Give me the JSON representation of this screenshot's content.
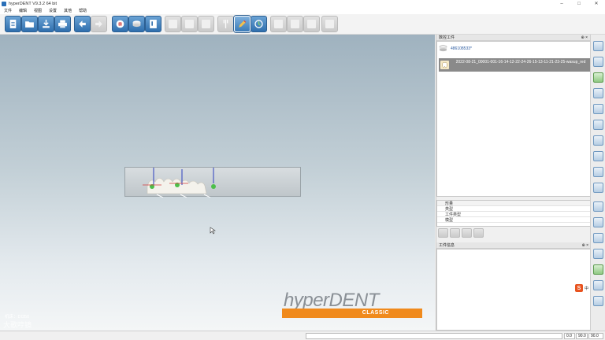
{
  "window": {
    "title": "hyperDENT V9.3.2 64 bit",
    "minimize": "–",
    "maximize": "□",
    "close": "✕"
  },
  "menu": [
    "文件",
    "编辑",
    "视图",
    "设置",
    "其他",
    "帮助"
  ],
  "toolbar": {
    "buttons": [
      {
        "icon": "new-document-icon",
        "state": "enabled"
      },
      {
        "icon": "open-folder-icon",
        "state": "enabled"
      },
      {
        "icon": "import-icon",
        "state": "enabled"
      },
      {
        "icon": "print-icon",
        "state": "enabled"
      },
      {
        "icon": "undo-arrow-icon",
        "state": "enabled"
      },
      {
        "icon": "redo-arrow-icon",
        "state": "disabled"
      },
      {
        "icon": "tooth-job-icon",
        "state": "enabled"
      },
      {
        "icon": "blank-disc-icon",
        "state": "enabled"
      },
      {
        "icon": "machine-icon",
        "state": "enabled"
      },
      {
        "icon": "grey-tool-1-icon",
        "state": "disabled"
      },
      {
        "icon": "grey-tool-2-icon",
        "state": "disabled"
      },
      {
        "icon": "grey-tool-3-icon",
        "state": "disabled"
      },
      {
        "icon": "fork-icon",
        "state": "enabled"
      },
      {
        "icon": "pencil-icon",
        "state": "active"
      },
      {
        "icon": "calculate-icon",
        "state": "enabled"
      },
      {
        "icon": "hand-icon",
        "state": "disabled"
      },
      {
        "icon": "gear-icon",
        "state": "disabled"
      },
      {
        "icon": "export-icon",
        "state": "disabled"
      },
      {
        "icon": "sync-icon",
        "state": "disabled"
      }
    ]
  },
  "viewport": {
    "machine_label": "机床：DI350",
    "brand_name": "hyperDENT",
    "brand_edition": "CLASSIC",
    "watermark": "大歌哼镜"
  },
  "panel": {
    "job_header": "数控工件",
    "pin": "⊕ ×",
    "blank_name": "486108533*",
    "job_name": "2022-08-21_00001-001-16-14-12-22-24-26-15-13-11-21-23-25-wasup_red",
    "props": [
      "形量",
      "类型",
      "工件类型",
      "模型"
    ],
    "info_header": "工件信息",
    "ime_label": "中"
  },
  "statusbar": {
    "field1": "",
    "zoom": "0.0",
    "angle1": "90.0",
    "angle2": "90.0"
  },
  "colors": {
    "accent": "#2f6fae",
    "brand_orange": "#f08a1c",
    "selected_row": "#8a8a8a"
  }
}
